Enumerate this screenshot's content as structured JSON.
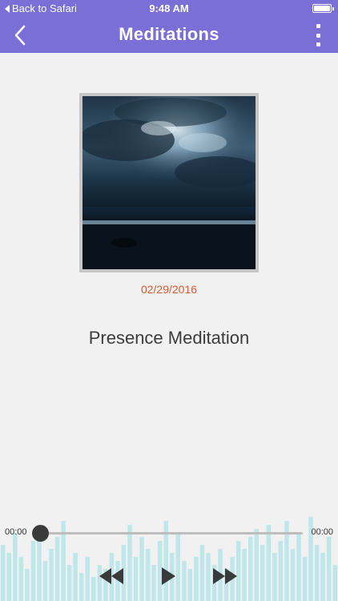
{
  "status_bar": {
    "back_label": "Back to Safari",
    "time": "9:48 AM"
  },
  "nav": {
    "title": "Meditations",
    "back_icon": "chevron-left-icon",
    "menu_icon": "more-vertical-icon"
  },
  "content": {
    "date": "02/29/2016",
    "title": "Presence Meditation"
  },
  "player": {
    "elapsed": "00:00",
    "remaining": "00:00",
    "progress": 0
  },
  "colors": {
    "accent": "#7a6fd6",
    "date": "#e05a2f",
    "waveform": "#bfe7ea"
  }
}
